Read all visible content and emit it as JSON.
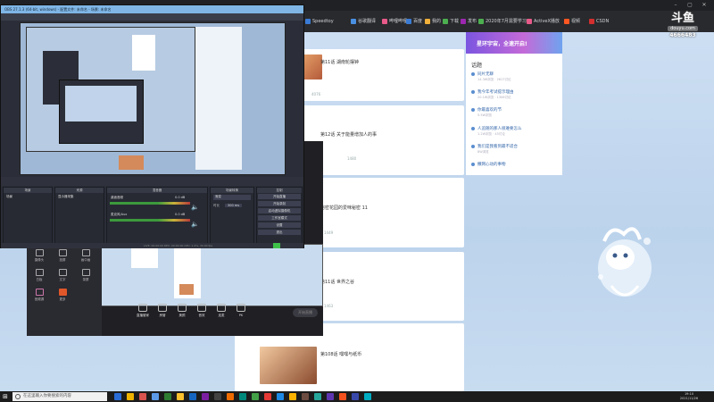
{
  "obs": {
    "title": "OBS 27.1.3 (64-bit, windows) - 配置文件: 未命名 - 场景: 未命名",
    "panels": [
      "场景",
      "来源",
      "混音器",
      "场景转换",
      "控制"
    ],
    "scene_item": "场景",
    "source_item": "显示器采集",
    "mixer_tracks": [
      "桌面音频",
      "麦克风/Aux"
    ],
    "mixer_levels": [
      "0.0 dB",
      "0.0 dB"
    ],
    "transition": "渐变",
    "duration_label": "时长",
    "duration_value": "300 ms",
    "controls": [
      "开始直播",
      "开始录制",
      "启动虚拟摄像机",
      "工作室模式",
      "设置",
      "退出"
    ],
    "footer": "LIVE: 00:00:00   REC: 00:00:00   CPU: 1.4%, 30.00 fps"
  },
  "live_panel": {
    "tools": [
      "摄像头",
      "投屏",
      "画中画",
      "白板",
      "文字",
      "录屏",
      "音频源",
      "更多"
    ],
    "bottom_tools": [
      "直播管家",
      "房管",
      "美颜",
      "音效",
      "连麦",
      "PK"
    ],
    "start_button": "开始直播"
  },
  "feed": {
    "items": [
      {
        "title": "第11话 湖南轮摆钟",
        "meta": "4076"
      },
      {
        "title": "第12话 关于能量增加人的事",
        "meta": "1480"
      },
      {
        "title": "秘密花园的爱咪秘密 11",
        "meta": "1449"
      },
      {
        "title": "第11话 世界之谷",
        "meta": "1463"
      },
      {
        "title": "第108话 嘿嘿与纸币",
        "meta": ""
      }
    ],
    "user_tag": "我的连跳弹幕"
  },
  "right": {
    "banner": "星环宇宙，全速开启!",
    "topics_title": "话题",
    "topics": [
      {
        "title": "同片无聊",
        "sub": "14.3W浏览 · 2617讨论"
      },
      {
        "title": "我今年考试提示理由",
        "sub": "20.1W浏览 · 1306讨论"
      },
      {
        "title": "你最喜欢的节",
        "sub": "5.5W浏览"
      },
      {
        "title": "人追随的那人很难要怎么",
        "sub": "1.2W浏览 · 45讨论"
      },
      {
        "title": "我们是我看到最不适合",
        "sub": "8W浏览"
      },
      {
        "title": "撒网心动的事物",
        "sub": "6W浏览"
      }
    ]
  },
  "logo": {
    "main": "斗鱼",
    "sub": "douyu.com",
    "id": "4666483"
  },
  "taskbar": {
    "search_placeholder": "在这里输入你要搜索的内容",
    "time": "19:10",
    "date": "2021/11/26"
  },
  "bookmarks": [
    "Speedtoy",
    "谷歌翻译",
    "哔哩哔哩",
    "百度",
    "我的",
    "下载",
    "发布",
    "2020年7月需要学习",
    "ActiveX播放",
    "视频",
    "CSDN"
  ],
  "colors": {
    "obs_titlebar": "#7fb6e6",
    "banner_start": "#7b55e0",
    "banner_end": "#6fa3ee",
    "accent_green": "#3ec24a"
  }
}
